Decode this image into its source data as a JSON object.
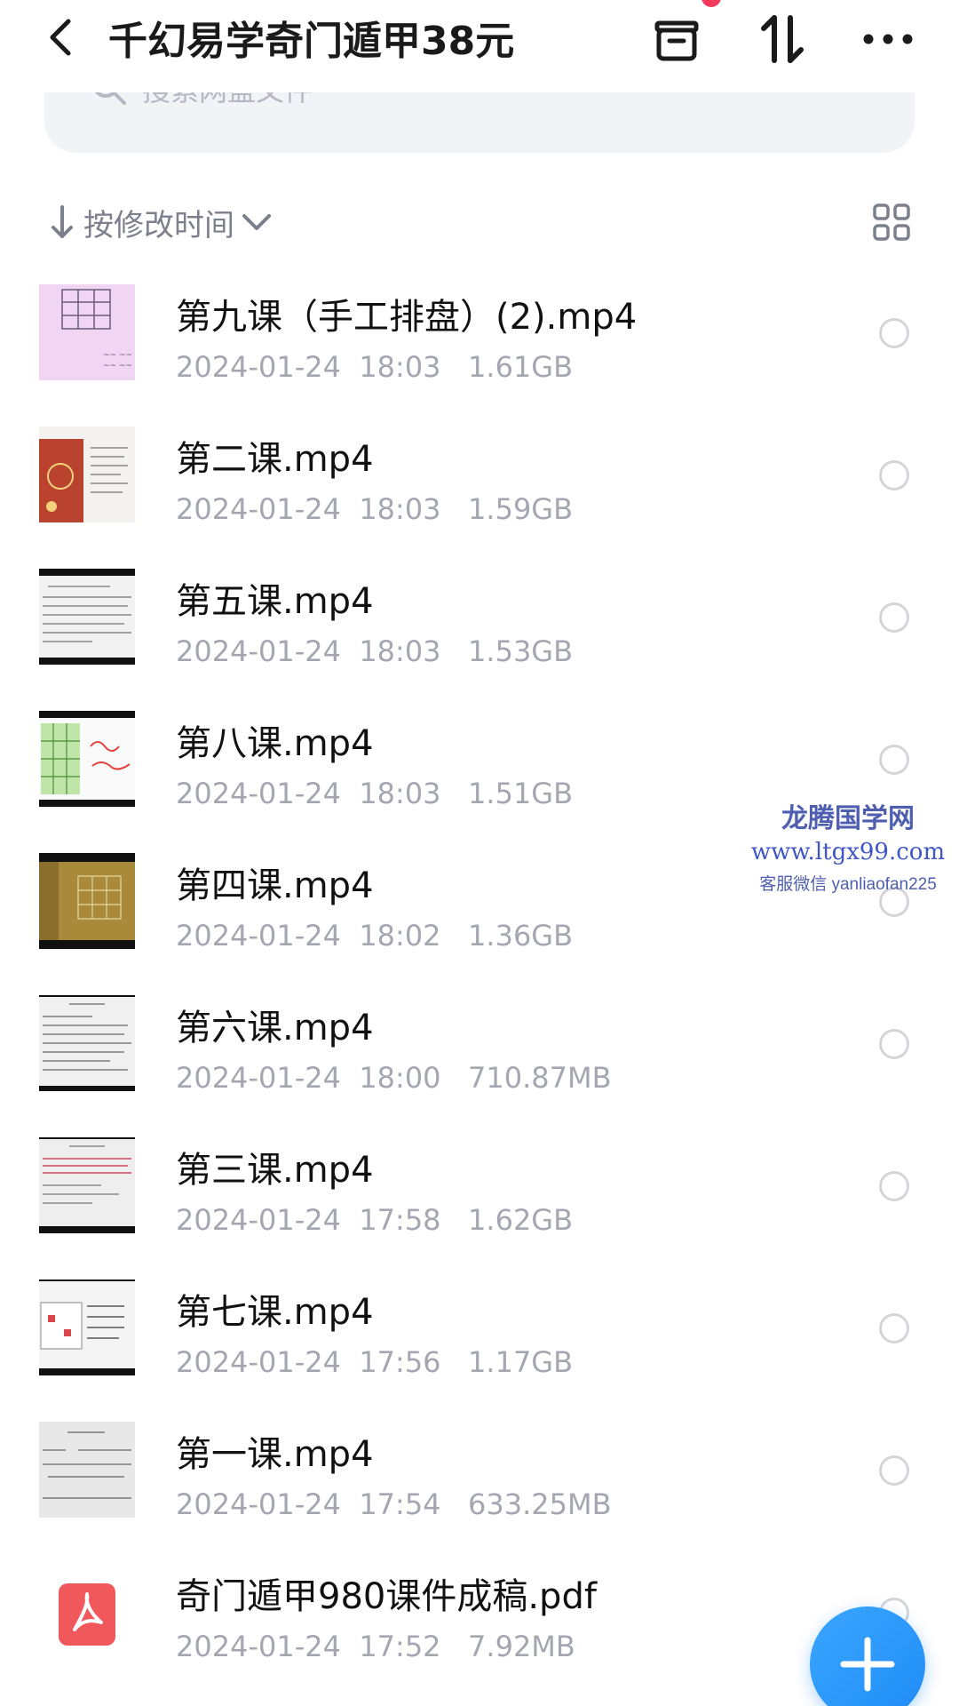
{
  "header": {
    "title": "千幻易学奇门遁甲38元",
    "back_icon": "chevron-left-icon",
    "icons": [
      "archive-box-icon",
      "sort-arrows-icon",
      "more-dots-icon"
    ]
  },
  "search": {
    "placeholder": "搜索网盘文件"
  },
  "sort": {
    "label": "按修改时间"
  },
  "files": [
    {
      "name": "第九课（手工排盘）(2).mp4",
      "meta": "2024-01-24  18:03   1.61GB",
      "thumb": "grid-sketch"
    },
    {
      "name": "第二课.mp4",
      "meta": "2024-01-24  18:03   1.59GB",
      "thumb": "red-slide"
    },
    {
      "name": "第五课.mp4",
      "meta": "2024-01-24  18:03   1.53GB",
      "thumb": "text-slide"
    },
    {
      "name": "第八课.mp4",
      "meta": "2024-01-24  18:03   1.51GB",
      "thumb": "green-chart"
    },
    {
      "name": "第四课.mp4",
      "meta": "2024-01-24  18:02   1.36GB",
      "thumb": "gold-grid"
    },
    {
      "name": "第六课.mp4",
      "meta": "2024-01-24  18:00   710.87MB",
      "thumb": "doc-slide"
    },
    {
      "name": "第三课.mp4",
      "meta": "2024-01-24  17:58   1.62GB",
      "thumb": "red-text-slide"
    },
    {
      "name": "第七课.mp4",
      "meta": "2024-01-24  17:56   1.17GB",
      "thumb": "table-slide"
    },
    {
      "name": "第一课.mp4",
      "meta": "2024-01-24  17:54   633.25MB",
      "thumb": "plain-slide"
    },
    {
      "name": "奇门遁甲980课件成稿.pdf",
      "meta": "2024-01-24  17:52   7.92MB",
      "thumb": "pdf-icon"
    }
  ],
  "watermark": {
    "line1": "龙腾国学网",
    "line2": "www.ltgx99.com",
    "line3": "客服微信 yanliaofan225"
  },
  "colors": {
    "accent": "#1e8cf6",
    "pdf_red": "#f0585c",
    "badge_red": "#f2395b"
  }
}
